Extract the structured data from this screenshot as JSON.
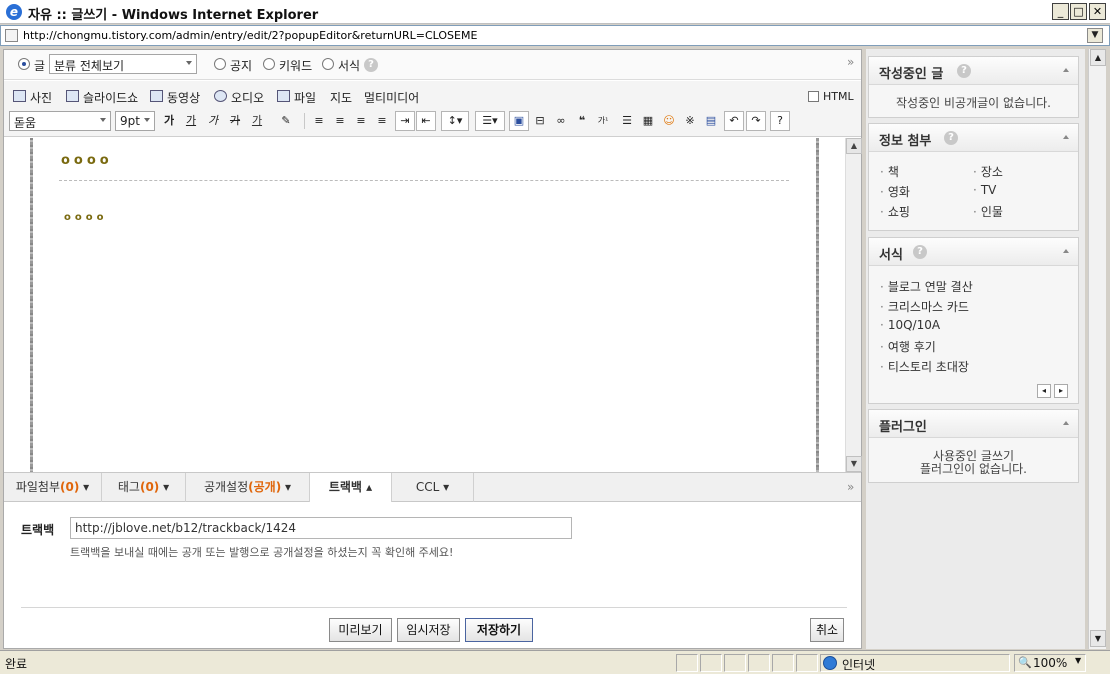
{
  "window": {
    "title": "자유 :: 글쓰기 - Windows Internet Explorer",
    "url": "http://chongmu.tistory.com/admin/entry/edit/2?popupEditor&returnURL=CLOSEME"
  },
  "category_bar": {
    "options": [
      {
        "label": "글",
        "selected": true
      },
      {
        "label": "공지",
        "selected": false
      },
      {
        "label": "키워드",
        "selected": false
      },
      {
        "label": "서식",
        "selected": false
      }
    ],
    "category_select": "분류 전체보기",
    "expand_symbol": "»"
  },
  "media_bar": {
    "items": [
      "사진",
      "슬라이드쇼",
      "동영상",
      "오디오",
      "파일",
      "지도",
      "멀티미디어"
    ],
    "html_label": "HTML",
    "html_checked": false
  },
  "format_bar": {
    "font": "돋움",
    "size": "9pt",
    "buttons": [
      "가",
      "가",
      "가",
      "가",
      "가"
    ]
  },
  "content": {
    "line1": "oooo",
    "line2": "oooo"
  },
  "tabs": [
    {
      "label": "파일첨부",
      "count": "(0)",
      "active": false
    },
    {
      "label": "태그",
      "count": "(0)",
      "active": false
    },
    {
      "label": "공개설정",
      "count": "(공개)",
      "active": false
    },
    {
      "label": "트랙백",
      "count": "",
      "active": true
    },
    {
      "label": "CCL",
      "count": "",
      "active": false
    }
  ],
  "trackback": {
    "label": "트랙백",
    "value": "http://jblove.net/b12/trackback/1424",
    "notice": "트랙백을 보내실 때에는 공개 또는 발행으로 공개설정을 하셨는지 꼭 확인해 주세요!"
  },
  "actions": {
    "preview": "미리보기",
    "temp_save": "임시저장",
    "save": "저장하기",
    "cancel": "취소"
  },
  "sidebar": {
    "drafts": {
      "title": "작성중인 글",
      "message": "작성중인 비공개글이 없습니다."
    },
    "info": {
      "title": "정보 첨부",
      "items": [
        "책",
        "장소",
        "영화",
        "TV",
        "쇼핑",
        "인물"
      ]
    },
    "templates": {
      "title": "서식",
      "items": [
        "블로그 연말 결산",
        "크리스마스 카드",
        "10Q/10A",
        "여행 후기",
        "티스토리 초대장"
      ]
    },
    "plugins": {
      "title": "플러그인",
      "message_line1": "사용중인 글쓰기",
      "message_line2": "플러그인이 없습니다."
    }
  },
  "status": {
    "left": "완료",
    "zone": "인터넷",
    "zoom": "100%"
  }
}
